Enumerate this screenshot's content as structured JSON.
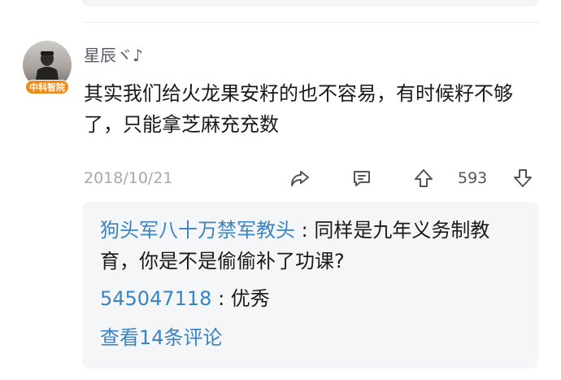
{
  "comment": {
    "username": "星辰ヾ♪",
    "badge": "中科智院",
    "text": "其实我们给火龙果安籽的也不容易，有时候籽不够了，只能拿芝麻充充数",
    "date": "2018/10/21",
    "vote_count": "593",
    "icons": [
      "share-icon",
      "reply-icon",
      "upvote-icon",
      "downvote-icon"
    ]
  },
  "replies": [
    {
      "author": "狗头军八十万禁军教头",
      "separator": " : ",
      "text": "同样是九年义务制教育，你是不是偷偷补了功课?"
    },
    {
      "author": "545047118",
      "separator": " : ",
      "text": "优秀"
    }
  ],
  "view_more": "查看14条评论",
  "colors": {
    "link": "#3a84c4",
    "badge": "#f08a1b",
    "reply_bg": "#f5f6f8",
    "meta": "#a8a8a8"
  }
}
